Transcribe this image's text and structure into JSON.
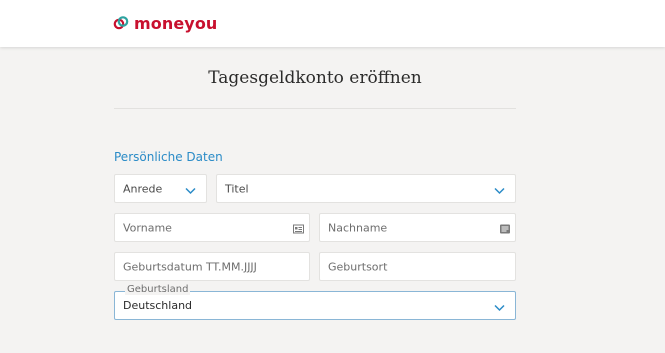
{
  "header": {
    "brand_name": "moneyou",
    "brand_color": "#c8102e"
  },
  "page": {
    "title": "Tagesgeldkonto eröffnen"
  },
  "section": {
    "title": "Persönliche Daten",
    "accent_color": "#2a8bc7"
  },
  "form": {
    "anrede": {
      "placeholder": "Anrede",
      "icon": "chevron-down-icon"
    },
    "titel": {
      "placeholder": "Titel",
      "icon": "chevron-down-icon"
    },
    "vorname": {
      "placeholder": "Vorname",
      "icon": "id-card-icon"
    },
    "nachname": {
      "placeholder": "Nachname",
      "icon": "id-card-icon"
    },
    "geburtsdatum": {
      "placeholder": "Geburtsdatum TT.MM.JJJJ"
    },
    "geburtsort": {
      "placeholder": "Geburtsort"
    },
    "geburtsland": {
      "label": "Geburtsland",
      "value": "Deutschland",
      "icon": "chevron-down-icon"
    }
  }
}
